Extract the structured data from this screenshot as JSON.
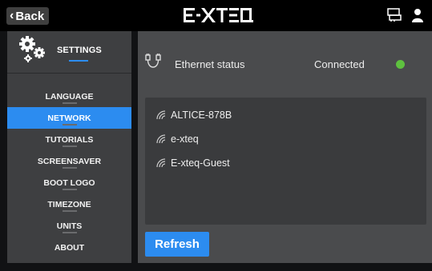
{
  "topbar": {
    "back_label": "Back",
    "logo_text": "E-XTEQ",
    "icons": [
      "network-icon",
      "user-icon"
    ]
  },
  "sidebar": {
    "title": "SETTINGS",
    "items": [
      {
        "label": "LANGUAGE",
        "active": false
      },
      {
        "label": "NETWORK",
        "active": true
      },
      {
        "label": "TUTORIALS",
        "active": false
      },
      {
        "label": "SCREENSAVER",
        "active": false
      },
      {
        "label": "BOOT LOGO",
        "active": false
      },
      {
        "label": "TIMEZONE",
        "active": false
      },
      {
        "label": "UNITS",
        "active": false
      },
      {
        "label": "ABOUT",
        "active": false
      }
    ]
  },
  "ethernet": {
    "label": "Ethernet status",
    "status": "Connected",
    "status_color": "#5ec13f"
  },
  "wifi": {
    "networks": [
      "ALTICE-878B",
      "e-xteq",
      "E-xteq-Guest"
    ]
  },
  "actions": {
    "refresh_label": "Refresh"
  },
  "colors": {
    "accent": "#2c8cf0",
    "background": "#111214",
    "panel": "#4a4b4d",
    "sidebar": "#3e3f41"
  }
}
